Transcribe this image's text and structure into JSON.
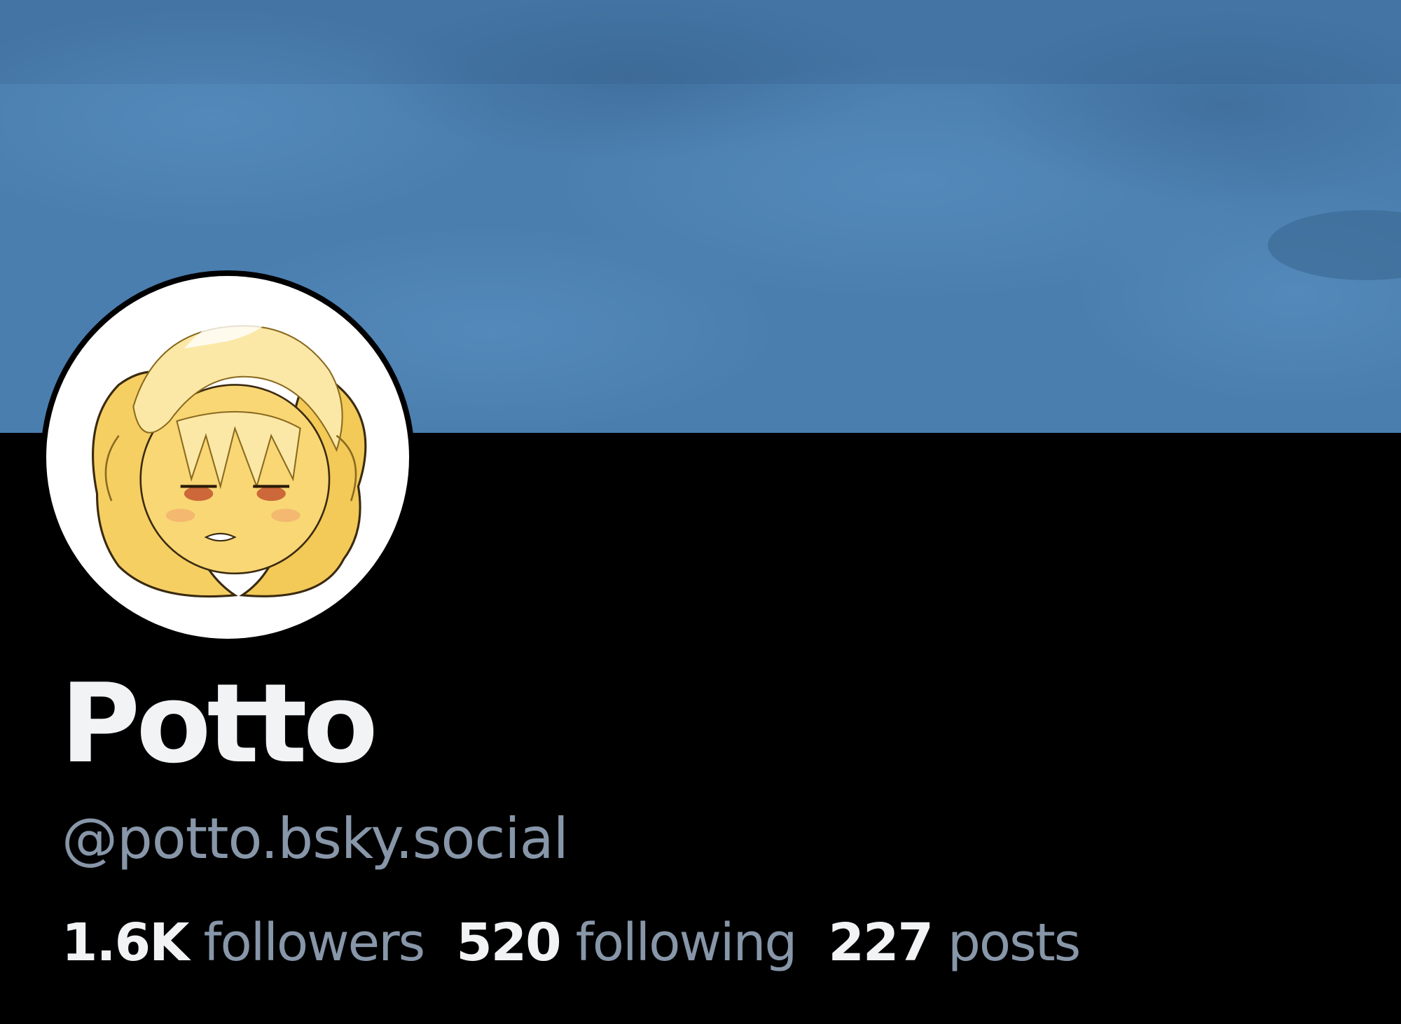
{
  "profile": {
    "display_name": "Potto",
    "handle": "@potto.bsky.social",
    "banner_icon": "banner-image",
    "avatar_icon": "avatar-image",
    "stats": [
      {
        "count": "1.6K",
        "label": "followers"
      },
      {
        "count": "520",
        "label": "following"
      },
      {
        "count": "227",
        "label": "posts"
      }
    ]
  },
  "colors": {
    "background": "#000000",
    "banner": "#4a7fae",
    "primary_text": "#f1f3f5",
    "secondary_text": "#8796a8",
    "avatar_ring": "#ffffff",
    "avatar_fill": "#f6cf63"
  }
}
